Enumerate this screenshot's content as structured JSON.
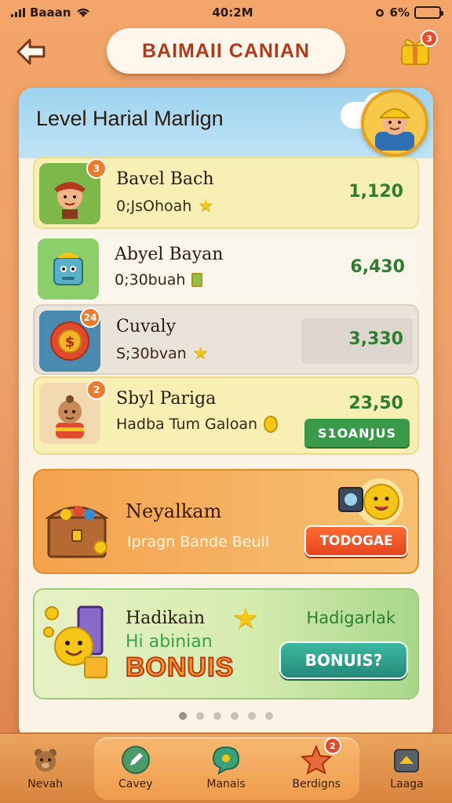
{
  "status_bar": {
    "carrier": "Baaan",
    "time": "40:2M",
    "battery": "6%"
  },
  "header": {
    "title": "BAIMAII CANIAN",
    "gift_badge": "3"
  },
  "panel": {
    "title": "Level Harial Marlign",
    "rows": [
      {
        "name": "Bavel Bach",
        "sub": "0;JsOhoah",
        "score": "1,120",
        "badge": "3"
      },
      {
        "name": "Abyel Bayan",
        "sub": "0;30buah",
        "score": "6,430"
      },
      {
        "name": "Cuvaly",
        "sub": "S;30bvan",
        "score": "3,330",
        "badge": "24"
      },
      {
        "name": "Sbyl Pariga",
        "sub": "Hadba Tum Galoan",
        "score": "23,50",
        "badge": "2",
        "button": "S1OANJUS"
      }
    ],
    "promo_treasure": {
      "title": "Neyalkam",
      "subtitle": "Ipragn Bande Beuil",
      "button": "TODOGAE"
    },
    "promo_bonus": {
      "title": "Hadikain",
      "line": "Hi abinian",
      "bonus_word": "BONUIS",
      "title_right": "Hadigarlak",
      "button": "BONUIS?"
    },
    "page_dots": 6,
    "active_dot": 0
  },
  "bottom_nav": {
    "items": [
      {
        "label": "Nevah",
        "icon": "bear-icon"
      },
      {
        "label": "Cavey",
        "icon": "pencil-icon"
      },
      {
        "label": "Manais",
        "icon": "chat-icon"
      },
      {
        "label": "Berdigns",
        "icon": "star-icon",
        "badge": "2"
      },
      {
        "label": "Laaga",
        "icon": "house-icon"
      }
    ]
  },
  "colors": {
    "accent": "#ef7a2c",
    "score_green": "#2e7d32",
    "title_red": "#b23a1c"
  }
}
